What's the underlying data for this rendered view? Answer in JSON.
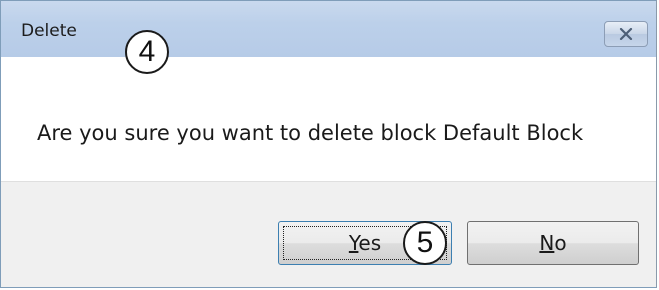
{
  "window": {
    "title": "Delete",
    "close_icon": "close-icon"
  },
  "message": {
    "text": "Are you sure you want to delete block Default Block"
  },
  "buttons": {
    "yes": {
      "mnemonic": "Y",
      "rest": "es",
      "default": true
    },
    "no": {
      "mnemonic": "N",
      "rest": "o"
    }
  },
  "callouts": {
    "title_marker": "4",
    "yes_marker": "5"
  },
  "colors": {
    "titlebar": "#bcd0ea",
    "footer": "#f0f0f0",
    "button_border": "#707070",
    "default_button_border": "#3c7fb1"
  }
}
